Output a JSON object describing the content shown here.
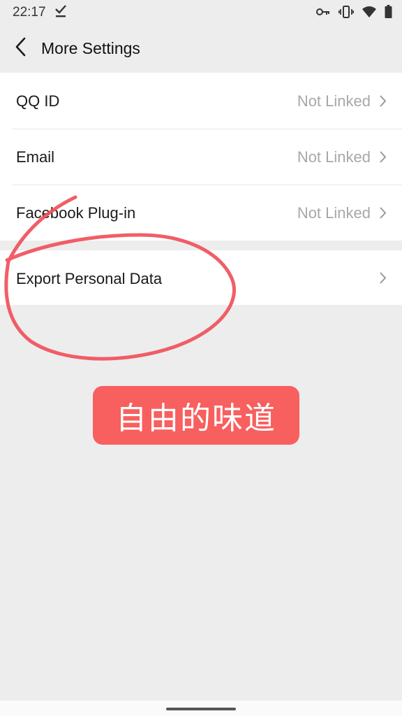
{
  "status_bar": {
    "time": "22:17",
    "icons": [
      "download-done-icon",
      "key-icon",
      "vibrate-icon",
      "wifi-icon",
      "battery-icon"
    ]
  },
  "header": {
    "title": "More Settings",
    "back_icon": "chevron-left-icon"
  },
  "accounts": [
    {
      "label": "QQ ID",
      "value": "Not Linked"
    },
    {
      "label": "Email",
      "value": "Not Linked"
    },
    {
      "label": "Facebook Plug-in",
      "value": "Not Linked"
    }
  ],
  "export": {
    "label": "Export Personal Data"
  },
  "watermark": {
    "text": "自由的味道"
  },
  "colors": {
    "background": "#ededed",
    "row_background": "#ffffff",
    "value_text": "#a8a8a8",
    "annotation": "#f0505a",
    "watermark_background": "#f85f5f"
  }
}
